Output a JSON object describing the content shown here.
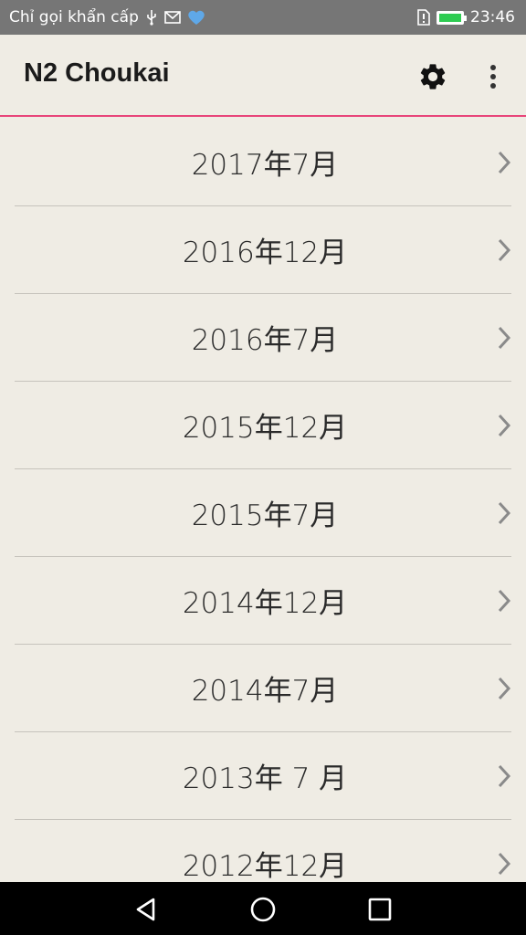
{
  "status_bar": {
    "carrier_text": "Chỉ gọi khẩn cấp",
    "time": "23:46",
    "icons": [
      "usb-icon",
      "mail-icon",
      "heart-icon",
      "sim-alert-icon",
      "battery-charging-icon"
    ],
    "battery_color": "#2ecc52"
  },
  "app_bar": {
    "title": "N2 Choukai",
    "accent_color": "#e8457a",
    "actions": [
      "gear-icon",
      "more-vert-icon"
    ]
  },
  "list": {
    "items": [
      {
        "label": "2017年7月"
      },
      {
        "label": "2016年12月"
      },
      {
        "label": "2016年7月"
      },
      {
        "label": "2015年12月"
      },
      {
        "label": "2015年7月"
      },
      {
        "label": "2014年12月"
      },
      {
        "label": "2014年7月"
      },
      {
        "label": "2013年 7 月"
      },
      {
        "label": "2012年12月"
      }
    ]
  },
  "nav_bar": {
    "buttons": [
      "back-triangle-icon",
      "home-circle-icon",
      "recents-square-icon"
    ]
  }
}
